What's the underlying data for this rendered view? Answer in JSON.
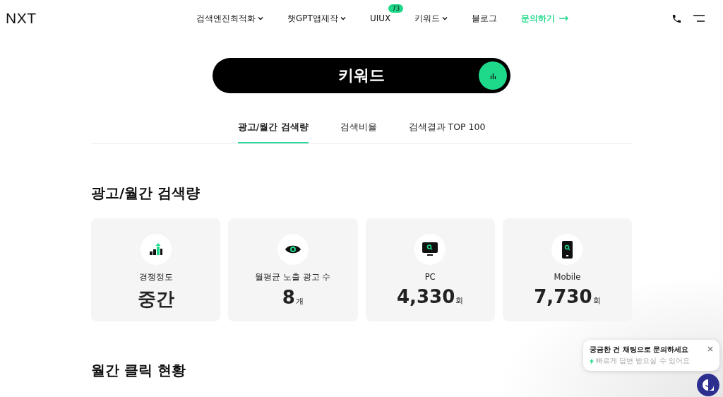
{
  "header": {
    "logo": "NXT",
    "nav": [
      {
        "label": "검색엔진최적화",
        "kind": "dropdown"
      },
      {
        "label": "챗GPT앱제작",
        "kind": "dropdown"
      },
      {
        "label": "UIUX",
        "kind": "badge",
        "badge": "73"
      },
      {
        "label": "키워드",
        "kind": "dropdown"
      },
      {
        "label": "블로그",
        "kind": "plain"
      },
      {
        "label": "문의하기",
        "kind": "cta"
      }
    ]
  },
  "hero": {
    "title": "키워드"
  },
  "tabs": [
    {
      "label": "광고/월간 검색량",
      "selected": true
    },
    {
      "label": "검색비율",
      "selected": false
    },
    {
      "label": "검색결과 TOP 100",
      "selected": false
    }
  ],
  "sections": [
    {
      "heading": "광고/월간 검색량",
      "cards": [
        {
          "kind": "growth",
          "label": "경쟁정도",
          "value": "중간"
        },
        {
          "kind": "eye",
          "label": "월평균 노출 광고 수",
          "value": "8",
          "unit": "개"
        },
        {
          "kind": "monitor",
          "label": "PC",
          "value": "4,330",
          "unit": "회"
        },
        {
          "kind": "phone",
          "label": "Mobile",
          "value": "7,730",
          "unit": "회"
        }
      ]
    },
    {
      "heading": "월간 클릭 현황"
    }
  ],
  "chat": {
    "title": "궁금한 건 채팅으로 문의하세요",
    "subtitle": "빠르게 답변 받으실 수 있어요"
  }
}
